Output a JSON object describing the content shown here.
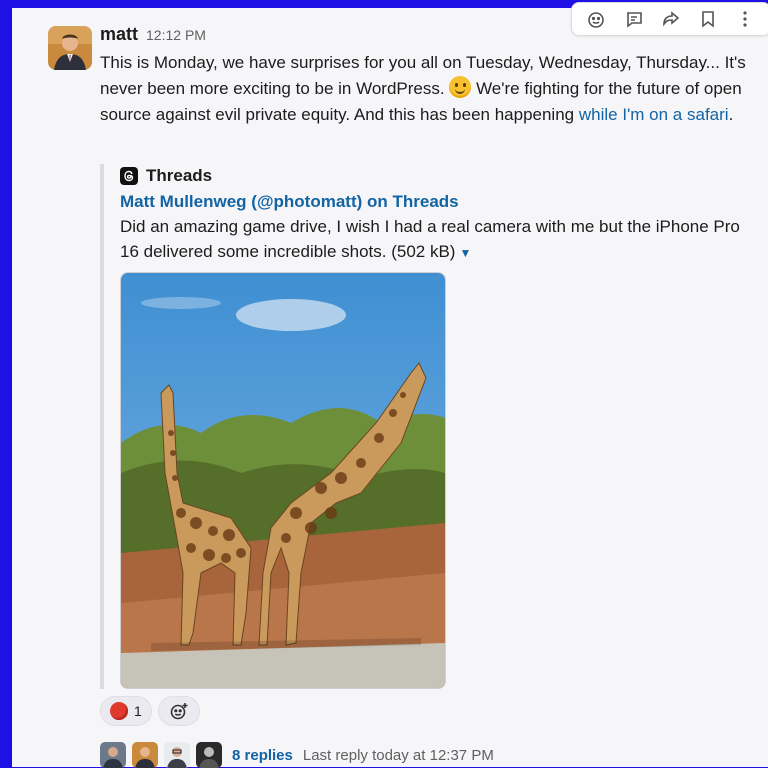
{
  "message": {
    "author": "matt",
    "time": "12:12 PM",
    "text_part1": "This is Monday, we have surprises for you all on Tuesday, Wednesday, Thursday... It's never been more exciting to be in WordPress.",
    "text_part2": "We're fighting for the future of open source against evil private equity. And this has been happening",
    "link_text": "while I'm on a safari",
    "text_end": "."
  },
  "attachment": {
    "source": "Threads",
    "title": "Matt Mullenweg (@photomatt) on Threads",
    "description": "Did an amazing game drive, I wish I had a real camera with me but the iPhone Pro 16 delivered some incredible shots. (502 kB)"
  },
  "reactions": [
    {
      "emoji": "red-circle",
      "count": "1"
    }
  ],
  "thread": {
    "replies": "8 replies",
    "last_reply": "Last reply today at 12:37 PM"
  },
  "toolbar_icons": [
    "add-reaction-icon",
    "reply-in-thread-icon",
    "share-icon",
    "bookmark-icon",
    "more-icon"
  ],
  "colors": {
    "link": "#1264a3",
    "background": "#f6f5f8",
    "frame_border": "#1a0fe0"
  }
}
